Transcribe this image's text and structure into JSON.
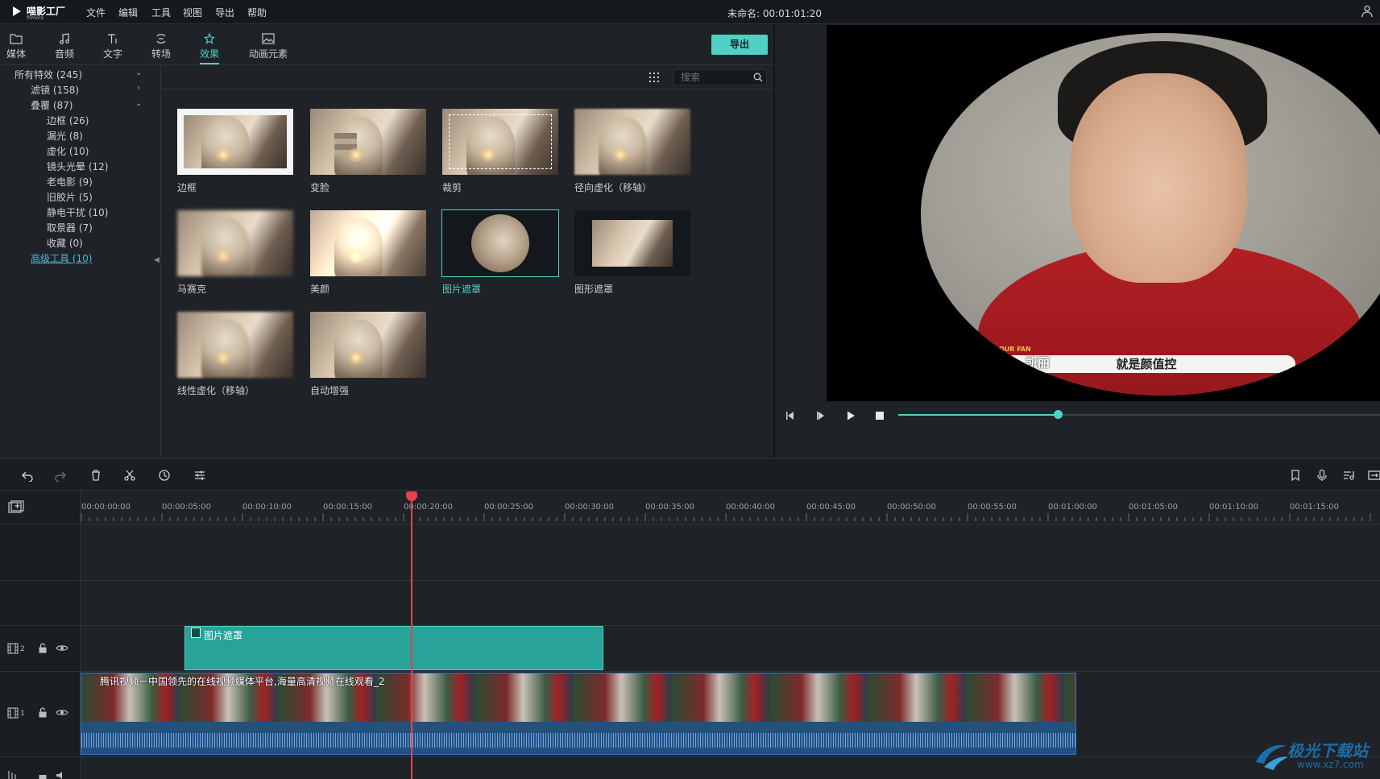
{
  "menubar": {
    "logo": "喵影工厂",
    "logo_sub": "filmora",
    "items": [
      "文件",
      "编辑",
      "工具",
      "视图",
      "导出",
      "帮助"
    ],
    "title": "未命名: 00:01:01:20"
  },
  "library_tabs": [
    {
      "label": "媒体",
      "icon": "folder-icon"
    },
    {
      "label": "音频",
      "icon": "music-note-icon"
    },
    {
      "label": "文字",
      "icon": "text-icon"
    },
    {
      "label": "转场",
      "icon": "transition-icon"
    },
    {
      "label": "效果",
      "icon": "effects-icon",
      "active": true
    },
    {
      "label": "动画元素",
      "icon": "image-icon"
    }
  ],
  "export_label": "导出",
  "tree": [
    {
      "label": "所有特效 (245)",
      "level": 0,
      "chevron": "down"
    },
    {
      "label": "滤镜 (158)",
      "level": 1,
      "chevron": "right"
    },
    {
      "label": "叠覆 (87)",
      "level": 1,
      "chevron": "down"
    },
    {
      "label": "边框 (26)",
      "level": 2
    },
    {
      "label": "漏光 (8)",
      "level": 2
    },
    {
      "label": "虚化 (10)",
      "level": 2
    },
    {
      "label": "镜头光晕 (12)",
      "level": 2
    },
    {
      "label": "老电影 (9)",
      "level": 2
    },
    {
      "label": "旧胶片 (5)",
      "level": 2
    },
    {
      "label": "静电干扰 (10)",
      "level": 2
    },
    {
      "label": "取景器 (7)",
      "level": 2
    },
    {
      "label": "收藏 (0)",
      "level": 2
    },
    {
      "label": "高级工具 (10)",
      "level": 1,
      "link": true
    }
  ],
  "search": {
    "placeholder": "搜索",
    "value": ""
  },
  "effects": [
    {
      "label": "边框",
      "variant": "frame"
    },
    {
      "label": "变脸",
      "variant": "pixelate"
    },
    {
      "label": "裁剪",
      "variant": "crop"
    },
    {
      "label": "径向虚化（移轴）",
      "variant": "radial"
    },
    {
      "label": "马赛克",
      "variant": "mosaic"
    },
    {
      "label": "美颜",
      "variant": "beauty"
    },
    {
      "label": "图片遮罩",
      "variant": "image-mask",
      "selected": true
    },
    {
      "label": "图形遮罩",
      "variant": "shape-mask"
    },
    {
      "label": "线性虚化（移轴）",
      "variant": "linear"
    },
    {
      "label": "自动增强",
      "variant": "enhance"
    }
  ],
  "preview": {
    "caption": "就是颜值控",
    "name_tag": "凯丽",
    "badge": "OUR FAN",
    "seek_progress": 0.33
  },
  "timeline": {
    "ruler": [
      "00:00:00:00",
      "00:00:05:00",
      "00:00:10:00",
      "00:00:15:00",
      "00:00:20:00",
      "00:00:25:00",
      "00:00:30:00",
      "00:00:35:00",
      "00:00:40:00",
      "00:00:45:00",
      "00:00:50:00",
      "00:00:55:00",
      "00:01:00:00",
      "00:01:05:00",
      "00:01:10:00",
      "00:01:15:00"
    ],
    "tracks": [
      {
        "number": "2"
      },
      {
        "number": "1"
      }
    ],
    "effect_clip": "图片遮罩",
    "video_clip": "腾讯视频－中国领先的在线视频媒体平台,海量高清视频在线观看_2"
  },
  "watermark": {
    "text": "极光下载站",
    "url": "www.xz7.com"
  },
  "colors": {
    "accent": "#4fd1c5",
    "playhead": "#e8414a",
    "clip": "#27a39a"
  }
}
